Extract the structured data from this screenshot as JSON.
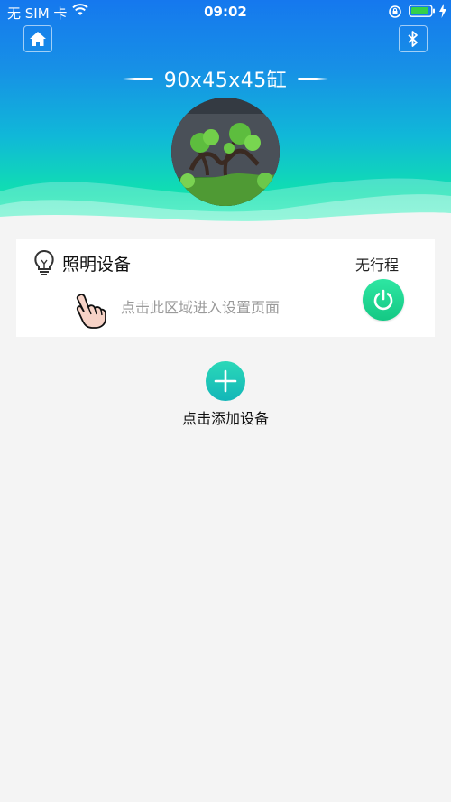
{
  "status_bar": {
    "carrier": "无 SIM 卡",
    "time": "09:02"
  },
  "header": {
    "tank_title": "90x45x45缸",
    "home_icon": "home-icon",
    "bluetooth_icon": "bluetooth-icon"
  },
  "device_card": {
    "name": "照明设备",
    "schedule_status": "无行程",
    "hint": "点击此区域进入设置页面",
    "icon": "lightbulb-icon",
    "power_color": "#1ed691"
  },
  "add_device": {
    "label": "点击添加设备"
  },
  "colors": {
    "header_top": "#1578ee",
    "header_bottom": "#2ef0b8",
    "background": "#f4f4f4"
  }
}
